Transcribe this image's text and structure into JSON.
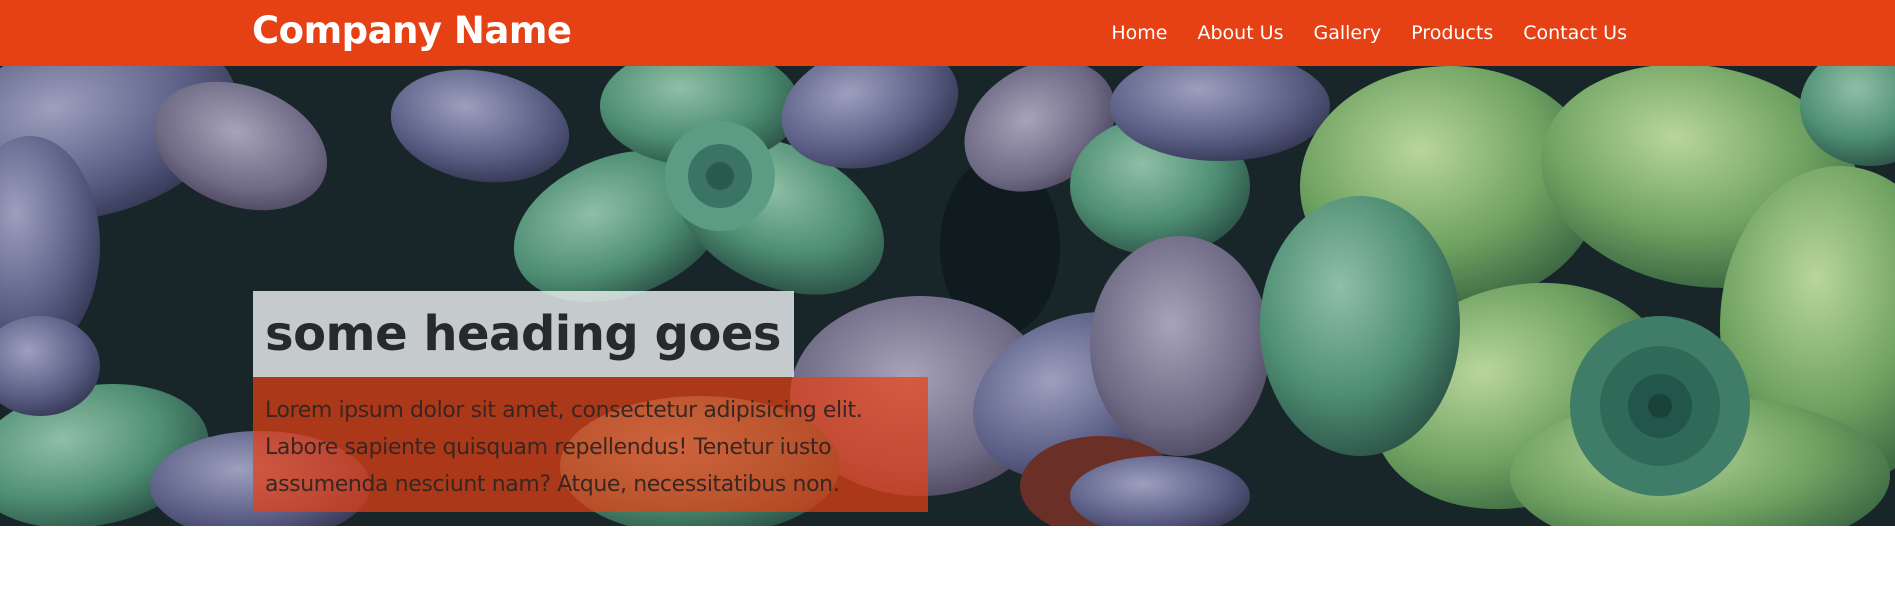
{
  "header": {
    "brand": "Company Name",
    "nav": [
      "Home",
      "About Us",
      "Gallery",
      "Products",
      "Contact Us"
    ]
  },
  "hero": {
    "heading": "some heading goes",
    "lines": [
      "Lorem ipsum dolor sit amet, consectetur adipisicing elit.",
      "Labore sapiente quisquam repellendus! Tenetur iusto",
      "assumenda nesciunt nam? Atque, necessitatibus non."
    ]
  },
  "colors": {
    "accent": "#e64015",
    "heading_bg": "#ecf0f1",
    "text_dark": "#27292d"
  },
  "icons": {
    "hero_image": "succulent-plants-photo"
  }
}
